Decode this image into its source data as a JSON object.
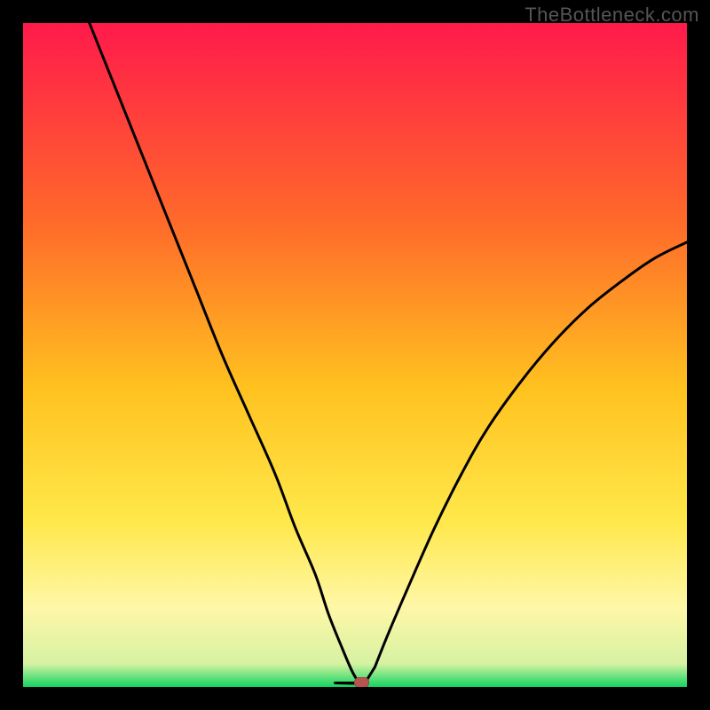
{
  "watermark": "TheBottleneck.com",
  "chart_data": {
    "type": "line",
    "title": "",
    "xlabel": "",
    "ylabel": "",
    "xlim": [
      0,
      100
    ],
    "ylim": [
      0,
      100
    ],
    "grid": false,
    "legend": false,
    "background_gradient": {
      "stops": [
        {
          "offset": 0.0,
          "color": "#ff1a4b"
        },
        {
          "offset": 0.3,
          "color": "#ff6a2a"
        },
        {
          "offset": 0.55,
          "color": "#ffc21f"
        },
        {
          "offset": 0.75,
          "color": "#ffe84a"
        },
        {
          "offset": 0.88,
          "color": "#fff7a8"
        },
        {
          "offset": 0.965,
          "color": "#d6f2a2"
        },
        {
          "offset": 1.0,
          "color": "#13d561"
        }
      ]
    },
    "series": [
      {
        "name": "bottleneck-curve",
        "x": [
          10,
          14,
          18,
          22,
          26,
          30,
          34,
          38,
          41,
          44,
          46,
          48,
          49.5,
          50.5,
          51,
          53,
          55,
          58,
          62,
          66,
          70,
          75,
          80,
          85,
          90,
          95,
          100
        ],
        "y": [
          100,
          90,
          80,
          70,
          60,
          50,
          41,
          32,
          24,
          17,
          11,
          6,
          2.5,
          0.8,
          0.5,
          3,
          8,
          15,
          24,
          32,
          39,
          46,
          52,
          57,
          61,
          64.5,
          67
        ]
      }
    ],
    "flat_segment": {
      "x_start": 47,
      "x_end": 51.5,
      "y": 0.6
    },
    "marker": {
      "x": 51,
      "y": 0.6,
      "name": "optimal-point"
    }
  }
}
